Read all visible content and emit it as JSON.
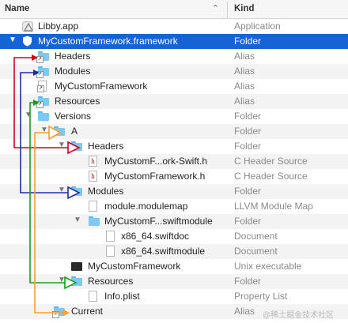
{
  "header": {
    "name_label": "Name",
    "kind_label": "Kind",
    "sort_icon": "chevron-up-icon"
  },
  "rows": [
    {
      "name": "Libby.app",
      "kind": "Application",
      "icon": "app-icon"
    },
    {
      "name": "MyCustomFramework.framework",
      "kind": "Folder",
      "icon": "framework-shield-icon",
      "selected": true,
      "expanded": true
    },
    {
      "name": "Headers",
      "kind": "Alias",
      "icon": "folder-alias-icon"
    },
    {
      "name": "Modules",
      "kind": "Alias",
      "icon": "folder-alias-icon"
    },
    {
      "name": "MyCustomFramework",
      "kind": "Alias",
      "icon": "file-alias-icon"
    },
    {
      "name": "Resources",
      "kind": "Alias",
      "icon": "folder-alias-icon"
    },
    {
      "name": "Versions",
      "kind": "Folder",
      "icon": "folder-icon",
      "expanded": true
    },
    {
      "name": "A",
      "kind": "Folder",
      "icon": "folder-icon",
      "expanded": true
    },
    {
      "name": "Headers",
      "kind": "Folder",
      "icon": "folder-icon",
      "expanded": true
    },
    {
      "name": "MyCustomF...ork-Swift.h",
      "kind": "C Header Source",
      "icon": "header-file-icon"
    },
    {
      "name": "MyCustomFramework.h",
      "kind": "C Header Source",
      "icon": "header-file-icon"
    },
    {
      "name": "Modules",
      "kind": "Folder",
      "icon": "folder-icon",
      "expanded": true
    },
    {
      "name": "module.modulemap",
      "kind": "LLVM Module Map",
      "icon": "document-icon"
    },
    {
      "name": "MyCustomF...swiftmodule",
      "kind": "Folder",
      "icon": "folder-icon",
      "expanded": true
    },
    {
      "name": "x86_64.swiftdoc",
      "kind": "Document",
      "icon": "document-icon"
    },
    {
      "name": "x86_64.swiftmodule",
      "kind": "Document",
      "icon": "document-icon"
    },
    {
      "name": "MyCustomFramework",
      "kind": "Unix executable",
      "icon": "executable-icon"
    },
    {
      "name": "Resources",
      "kind": "Folder",
      "icon": "folder-icon",
      "expanded": true
    },
    {
      "name": "Info.plist",
      "kind": "Property List",
      "icon": "plist-icon"
    },
    {
      "name": "Current",
      "kind": "Alias",
      "icon": "folder-alias-icon"
    }
  ],
  "annotations": {
    "colors": {
      "headers": "#d0021b",
      "modules": "#1f2f9e",
      "resources": "#16a01a",
      "current": "#f5a031"
    }
  },
  "watermark": "@稀土掘金技术社区"
}
